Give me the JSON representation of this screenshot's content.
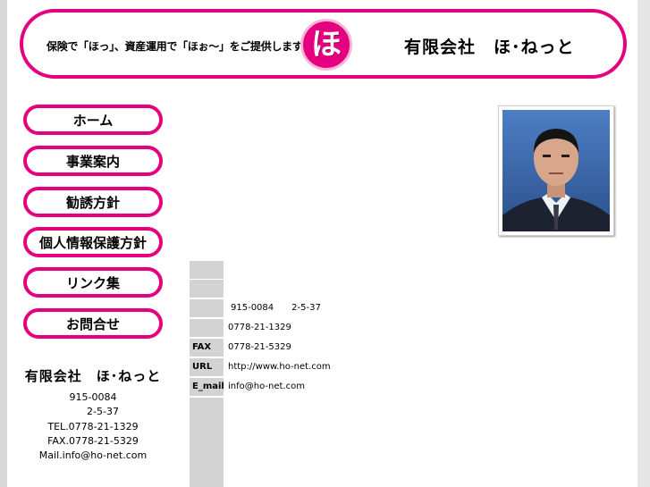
{
  "header": {
    "tagline": "保険で「ほっ」、資産運用で「ほぉ～」をご提供します。",
    "logo_char": "ほ",
    "company": "有限会社　ほ･ねっと"
  },
  "nav": [
    {
      "label": "ホーム"
    },
    {
      "label": "事業案内"
    },
    {
      "label": "勧誘方針"
    },
    {
      "label": "個人情報保護方針"
    },
    {
      "label": "リンク集"
    },
    {
      "label": "お問合せ"
    }
  ],
  "side_info": {
    "company": "有限会社　ほ･ねっと",
    "postal": "915-0084",
    "address": "2-5-37",
    "tel": "TEL.0778-21-1329",
    "fax": "FAX.0778-21-5329",
    "mail": "Mail.info@ho-net.com"
  },
  "info_table": [
    {
      "label": "",
      "value": ""
    },
    {
      "label": "",
      "value": ""
    },
    {
      "label": "",
      "value": "915-0084　　2-5-37"
    },
    {
      "label": "",
      "value": "0778-21-1329"
    },
    {
      "label": "FAX",
      "value": "0778-21-5329"
    },
    {
      "label": "URL",
      "value": "http://www.ho-net.com"
    },
    {
      "label": "E_mail",
      "value": "info@ho-net.com"
    }
  ],
  "colors": {
    "accent": "#e4007f",
    "label_bg": "#d3d3d3"
  }
}
